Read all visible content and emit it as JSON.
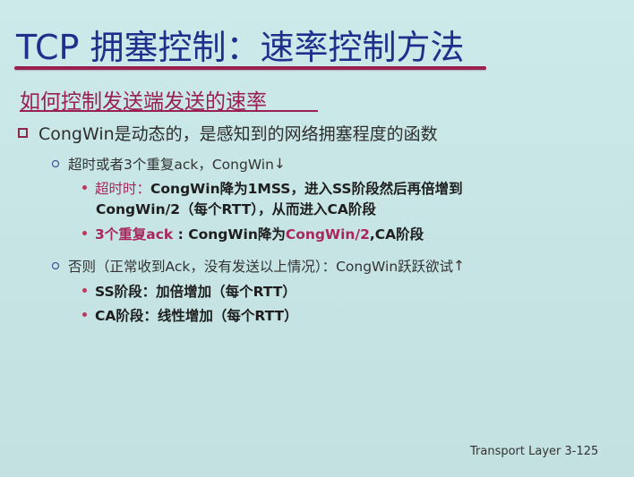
{
  "slide": {
    "title": "TCP 拥塞控制：速率控制方法",
    "subtitle": "如何控制发送端发送的速率",
    "point1": "CongWin是动态的，是感知到的网络拥塞程度的函数",
    "sub1": {
      "text": "超时或者3个重复ack，CongWin",
      "arrow": "↓",
      "items": [
        {
          "label": "超时时：",
          "text": "CongWin降为1MSS，进入SS阶段然后再倍增到",
          "text2": "CongWin/2（每个RTT），从而进入CA阶段"
        },
        {
          "label": "3个重复ack",
          "sep": " : ",
          "text": "CongWin降为",
          "mag": "CongWin/2",
          "tail": ",CA阶段"
        }
      ]
    },
    "sub2": {
      "text": "否则（正常收到Ack，没有发送以上情况）：CongWin跃跃欲试",
      "arrow": "↑",
      "items": [
        {
          "text": "SS阶段：加倍增加（每个RTT）"
        },
        {
          "text": "CA阶段：线性增加（每个RTT）"
        }
      ]
    },
    "footer": "Transport Layer 3-125"
  },
  "colors": {
    "title": "#1e2f8c",
    "accent": "#9a2050",
    "background": "#c6e4e4",
    "bullet_square": "#8a2a4a",
    "bullet_circle": "#2c3a8c",
    "bullet_dot": "#b83a5e"
  },
  "icons": {
    "l1": "square-bullet-icon",
    "l2": "circle-bullet-icon",
    "l3": "dot-bullet-icon"
  }
}
